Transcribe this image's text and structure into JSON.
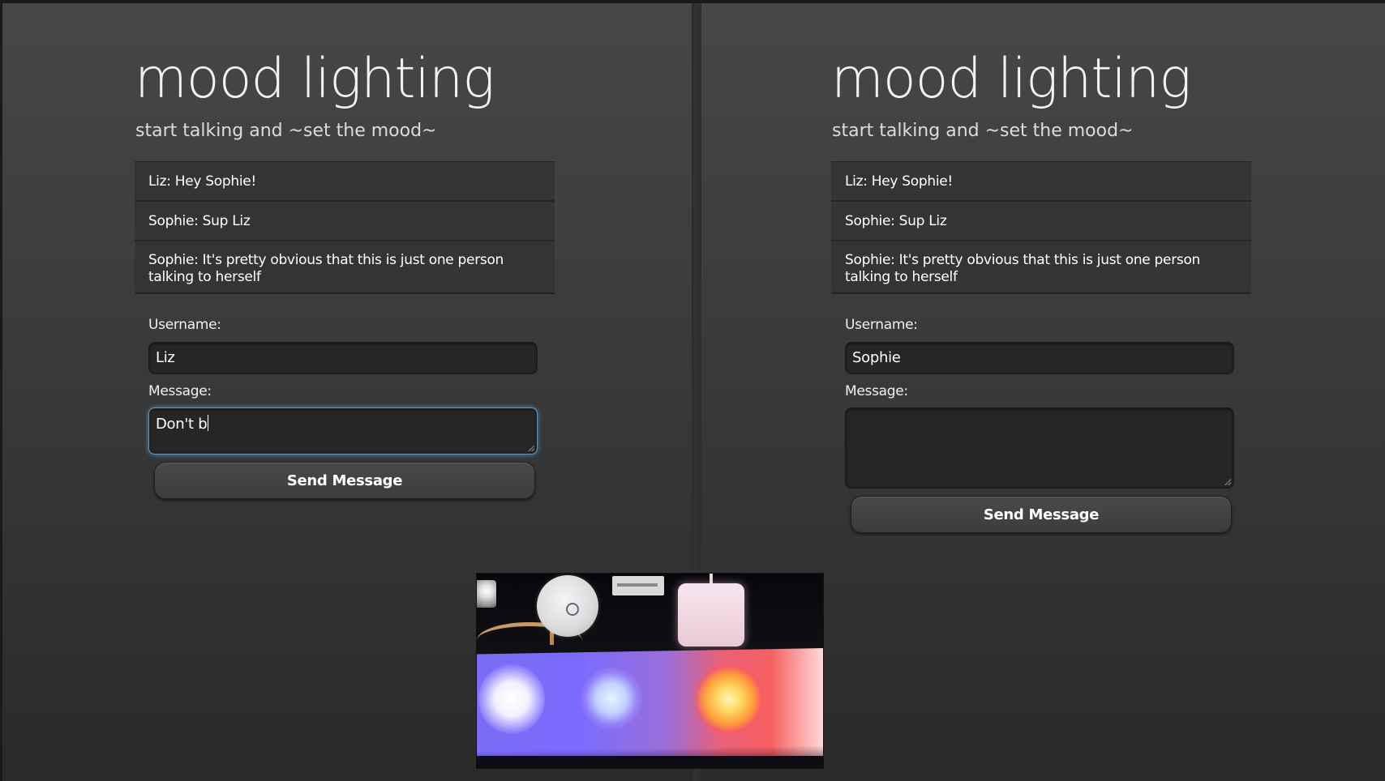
{
  "panels": [
    {
      "title": "mood lighting",
      "subtitle": "start talking and ~set the mood~",
      "messages": [
        "Liz: Hey Sophie!",
        "Sophie: Sup Liz",
        "Sophie: It's pretty obvious that this is just one person talking to herself"
      ],
      "username_label": "Username:",
      "username_value": "Liz",
      "message_label": "Message:",
      "message_value": "Don't b",
      "send_label": "Send Message"
    },
    {
      "title": "mood lighting",
      "subtitle": "start talking and ~set the mood~",
      "messages": [
        "Liz: Hey Sophie!",
        "Sophie: Sup Liz",
        "Sophie: It's pretty obvious that this is just one person talking to herself"
      ],
      "username_label": "Username:",
      "username_value": "Sophie",
      "message_label": "Message:",
      "message_value": "",
      "send_label": "Send Message"
    }
  ],
  "colors": {
    "background_top": "#474747",
    "background_bottom": "#2a2a2a",
    "message_row": "#343434",
    "input_bg": "#262626",
    "focus_glow": "#5e8fb0",
    "light_purple": "#7d6bff",
    "light_red": "#f76060",
    "light_yellow": "#ffd660"
  },
  "video": {
    "content": "webcam view of lights"
  }
}
